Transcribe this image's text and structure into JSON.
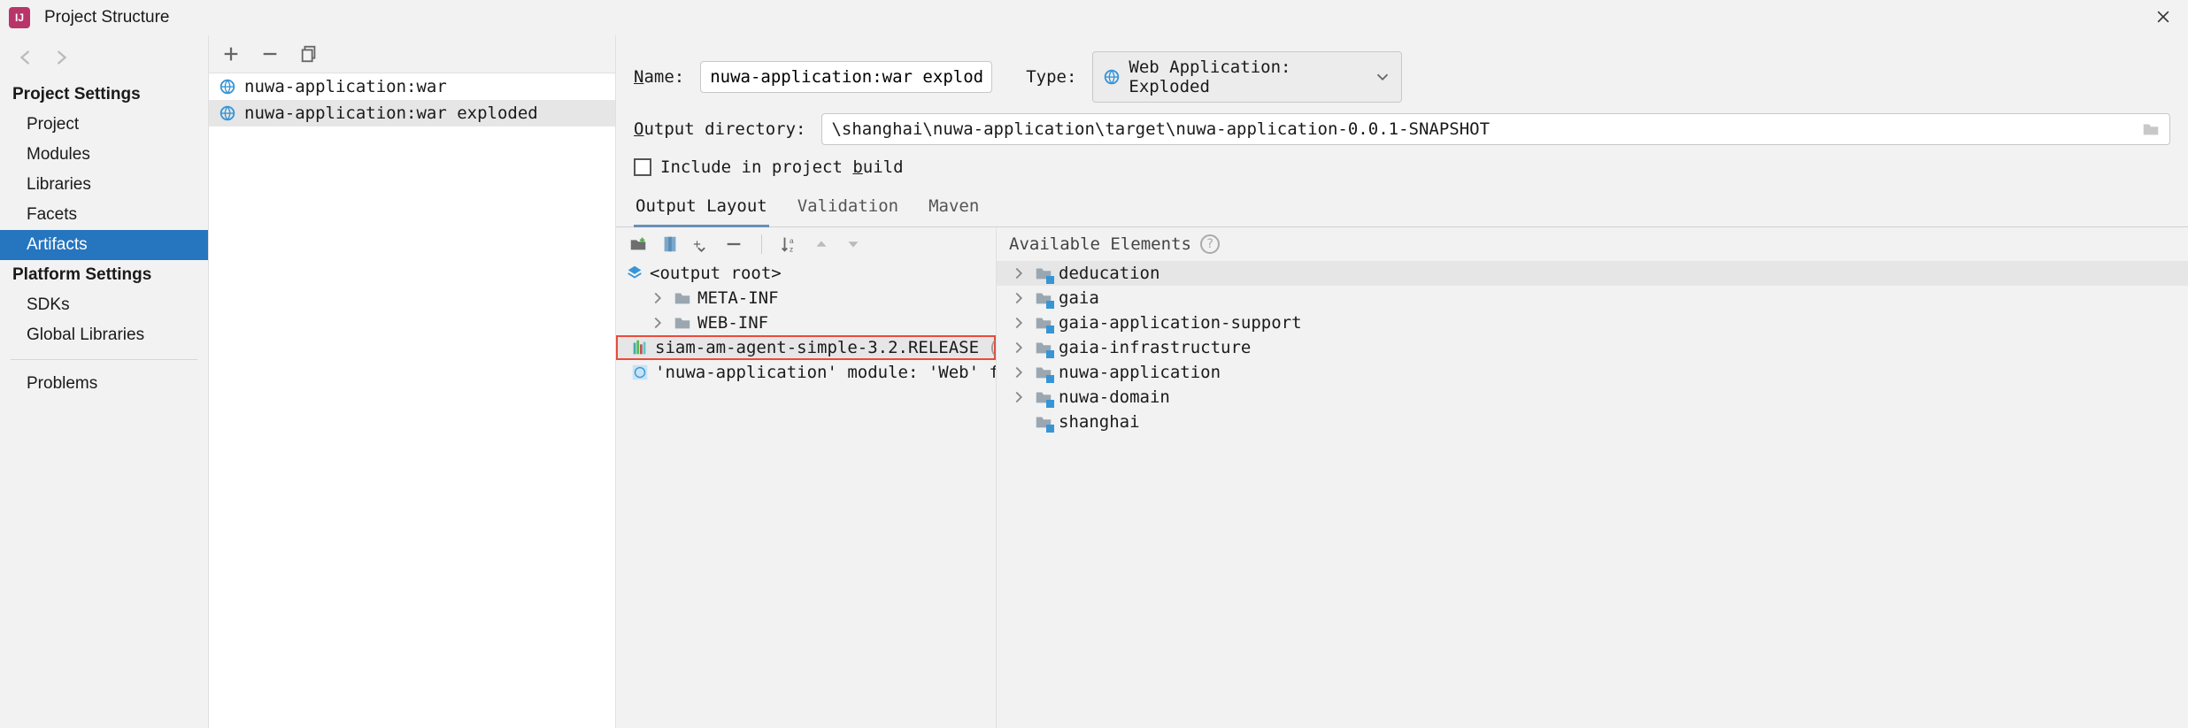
{
  "window": {
    "title": "Project Structure"
  },
  "sidebar": {
    "section_project": "Project Settings",
    "items_project": [
      "Project",
      "Modules",
      "Libraries",
      "Facets",
      "Artifacts"
    ],
    "section_platform": "Platform Settings",
    "items_platform": [
      "SDKs",
      "Global Libraries"
    ],
    "problems": "Problems",
    "selected": "Artifacts"
  },
  "artifacts": {
    "items": [
      "nuwa-application:war",
      "nuwa-application:war exploded"
    ],
    "selected_index": 1
  },
  "detail": {
    "name_label": "Name:",
    "name_value": "nuwa-application:war exploded",
    "type_label": "Type:",
    "type_value": "Web Application: Exploded",
    "outdir_label": "Output directory:",
    "outdir_value": "\\shanghai\\nuwa-application\\target\\nuwa-application-0.0.1-SNAPSHOT",
    "include_label_pre": "Include in project ",
    "include_label_u": "b",
    "include_label_post": "uild",
    "tabs": [
      "Output Layout",
      "Validation",
      "Maven"
    ],
    "active_tab": 0
  },
  "output_tree": {
    "root": "<output root>",
    "items": [
      {
        "name": "META-INF",
        "kind": "folder"
      },
      {
        "name": "WEB-INF",
        "kind": "folder"
      },
      {
        "name": "siam-am-agent-simple-3.2.RELEASE",
        "kind": "lib",
        "suffix": "(Proje",
        "highlighted": true
      },
      {
        "name": "'nuwa-application' module: 'Web' facet",
        "kind": "facet",
        "truncated": true
      }
    ]
  },
  "available": {
    "header": "Available Elements",
    "items": [
      {
        "name": "deducation",
        "selected": true
      },
      {
        "name": "gaia"
      },
      {
        "name": "gaia-application-support"
      },
      {
        "name": "gaia-infrastructure"
      },
      {
        "name": "nuwa-application"
      },
      {
        "name": "nuwa-domain"
      },
      {
        "name": "shanghai"
      }
    ]
  }
}
